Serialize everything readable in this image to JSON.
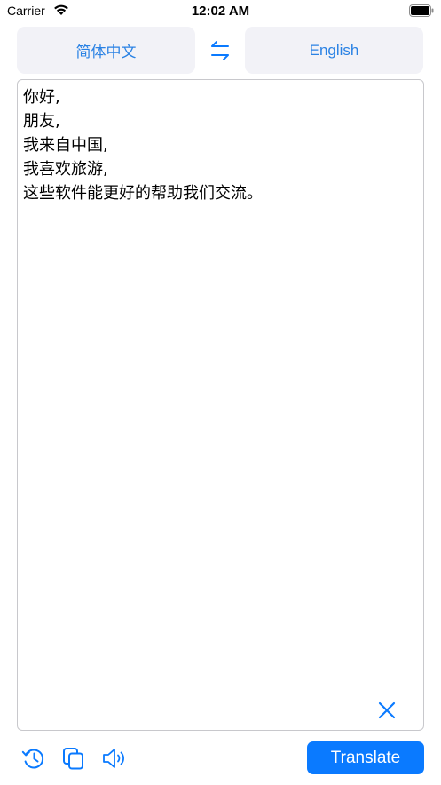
{
  "status_bar": {
    "carrier": "Carrier",
    "time": "12:02 AM",
    "icons": [
      "wifi-icon",
      "battery-icon"
    ]
  },
  "language_bar": {
    "source_language": "简体中文",
    "target_language": "English",
    "swap_icon": "swap-arrows-icon"
  },
  "editor": {
    "text": "你好,\n朋友,\n我来自中国,\n我喜欢旅游,\n这些软件能更好的帮助我们交流。",
    "clear_icon": "close-icon"
  },
  "toolbar": {
    "icons": [
      "history-icon",
      "copy-icon",
      "speaker-icon"
    ],
    "translate_label": "Translate"
  },
  "colors": {
    "accent": "#0a7aff",
    "lang_text": "#2a82e4",
    "lang_bg": "#f2f2f7",
    "border": "#c8c8cc"
  }
}
